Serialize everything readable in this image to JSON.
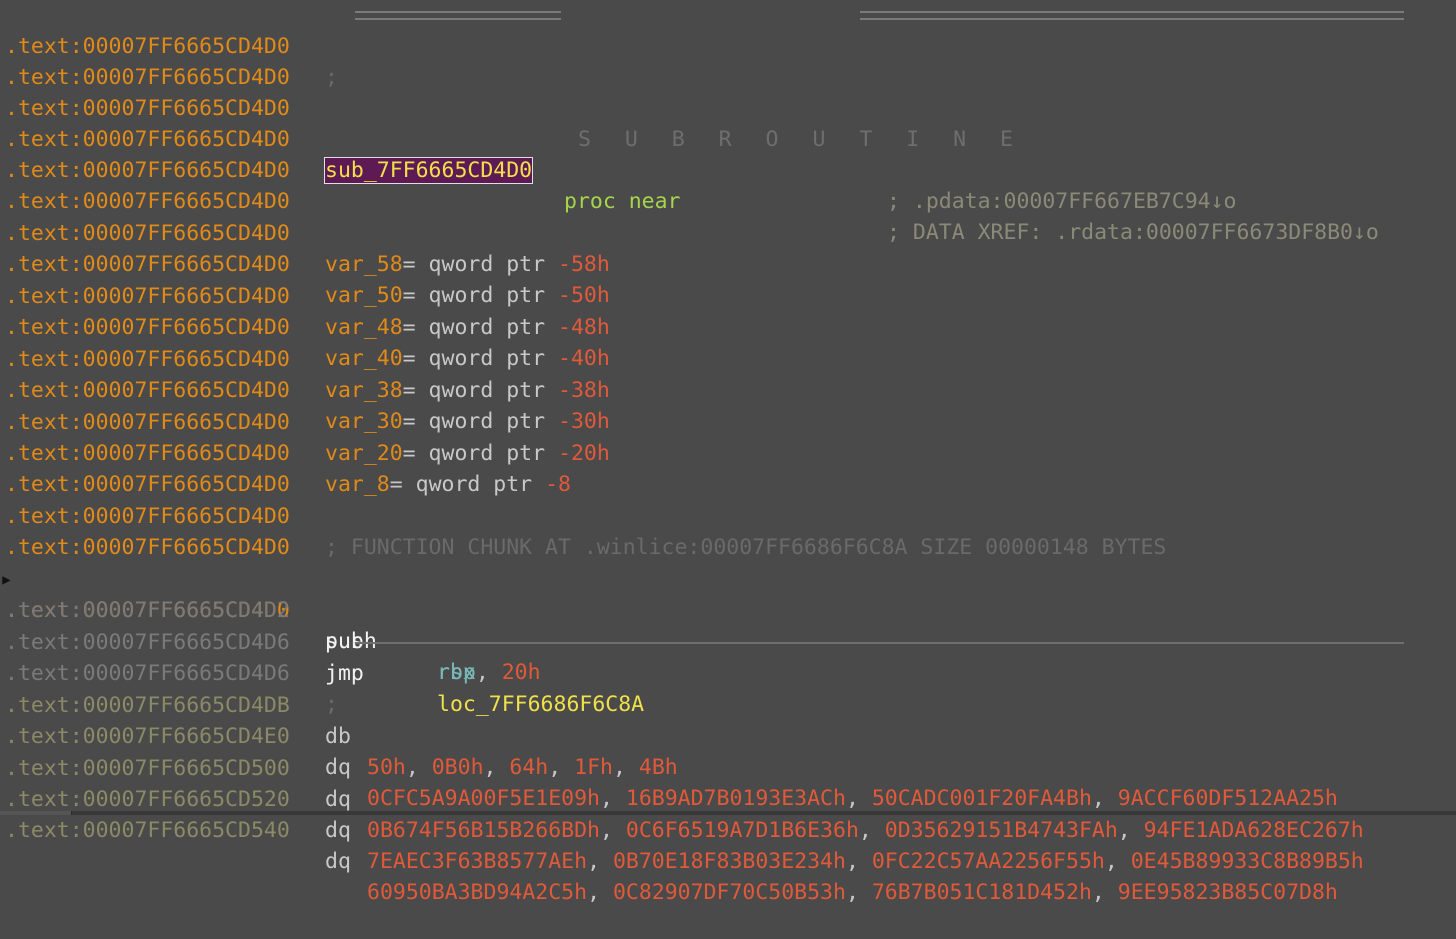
{
  "listing": {
    "header": {
      "address": ".text:00007FF6665CD4D0",
      "semicolon": ";",
      "title": "S U B R O U T I N E"
    },
    "blank_address": ".text:00007FF6665CD4D0",
    "proc_line": {
      "address": ".text:00007FF6665CD4D0",
      "name": "sub_7FF6665CD4D0",
      "keyword": "proc near",
      "xref": "; DATA XREF: .rdata:00007FF6673DF8B0↓o"
    },
    "xref2": "; .pdata:00007FF667EB7C94↓o",
    "vars": [
      {
        "name": "var_58",
        "decl": "= qword ptr ",
        "value": "-58h"
      },
      {
        "name": "var_50",
        "decl": "= qword ptr ",
        "value": "-50h"
      },
      {
        "name": "var_48",
        "decl": "= qword ptr ",
        "value": "-48h"
      },
      {
        "name": "var_40",
        "decl": "= qword ptr ",
        "value": "-40h"
      },
      {
        "name": "var_38",
        "decl": "= qword ptr ",
        "value": "-38h"
      },
      {
        "name": "var_30",
        "decl": "= qword ptr ",
        "value": "-30h"
      },
      {
        "name": "var_20",
        "decl": "= qword ptr ",
        "value": "-20h"
      },
      {
        "name": "var_8",
        "decl": "= qword ptr ",
        "value": "-8"
      }
    ],
    "chunk_comment": "; FUNCTION CHUNK AT .winlice:00007FF6686F6C8A SIZE 00000148 BYTES",
    "instructions": [
      {
        "address": ".text:00007FF6665CD4D0",
        "mnemonic": "push",
        "op1": "rbx",
        "op2": ""
      },
      {
        "address": ".text:00007FF6665CD4D2",
        "mnemonic": "sub",
        "op1": "rsp",
        "op2": "20h"
      },
      {
        "address": ".text:00007FF6665CD4D6",
        "mnemonic": "jmp",
        "op1": "loc_7FF6686F6C8A",
        "op2": ""
      }
    ],
    "sep_line": {
      "address": ".text:00007FF6665CD4D6",
      "semicolon": ";"
    },
    "db_line": {
      "address": ".text:00007FF6665CD4DB",
      "directive": "db",
      "values": [
        "50h",
        "0B0h",
        "64h",
        "1Fh",
        "4Bh"
      ]
    },
    "dq_lines": [
      {
        "address": ".text:00007FF6665CD4E0",
        "directive": "dq",
        "values": [
          "0CFC5A9A00F5E1E09h",
          "16B9AD7B0193E3ACh",
          "50CADC001F20FA4Bh",
          "9ACCF60DF512AA25h"
        ]
      },
      {
        "address": ".text:00007FF6665CD500",
        "directive": "dq",
        "values": [
          "0B674F56B15B266BDh",
          "0C6F6519A7D1B6E36h",
          "0D35629151B4743FAh",
          "94FE1ADA628EC267h"
        ]
      },
      {
        "address": ".text:00007FF6665CD520",
        "directive": "dq",
        "values": [
          "7EAEC3F63B8577AEh",
          "0B70E18F83B03E234h",
          "0FC22C57AA2256F55h",
          "0E45B89933C8B89B5h"
        ]
      },
      {
        "address": ".text:00007FF6665CD540",
        "directive": "dq",
        "values": [
          "60950BA3BD94A2C5h",
          "0C82907DF70C50B53h",
          "76B7B051C181D452h",
          "9EE95823B85C07D8h"
        ]
      }
    ]
  }
}
